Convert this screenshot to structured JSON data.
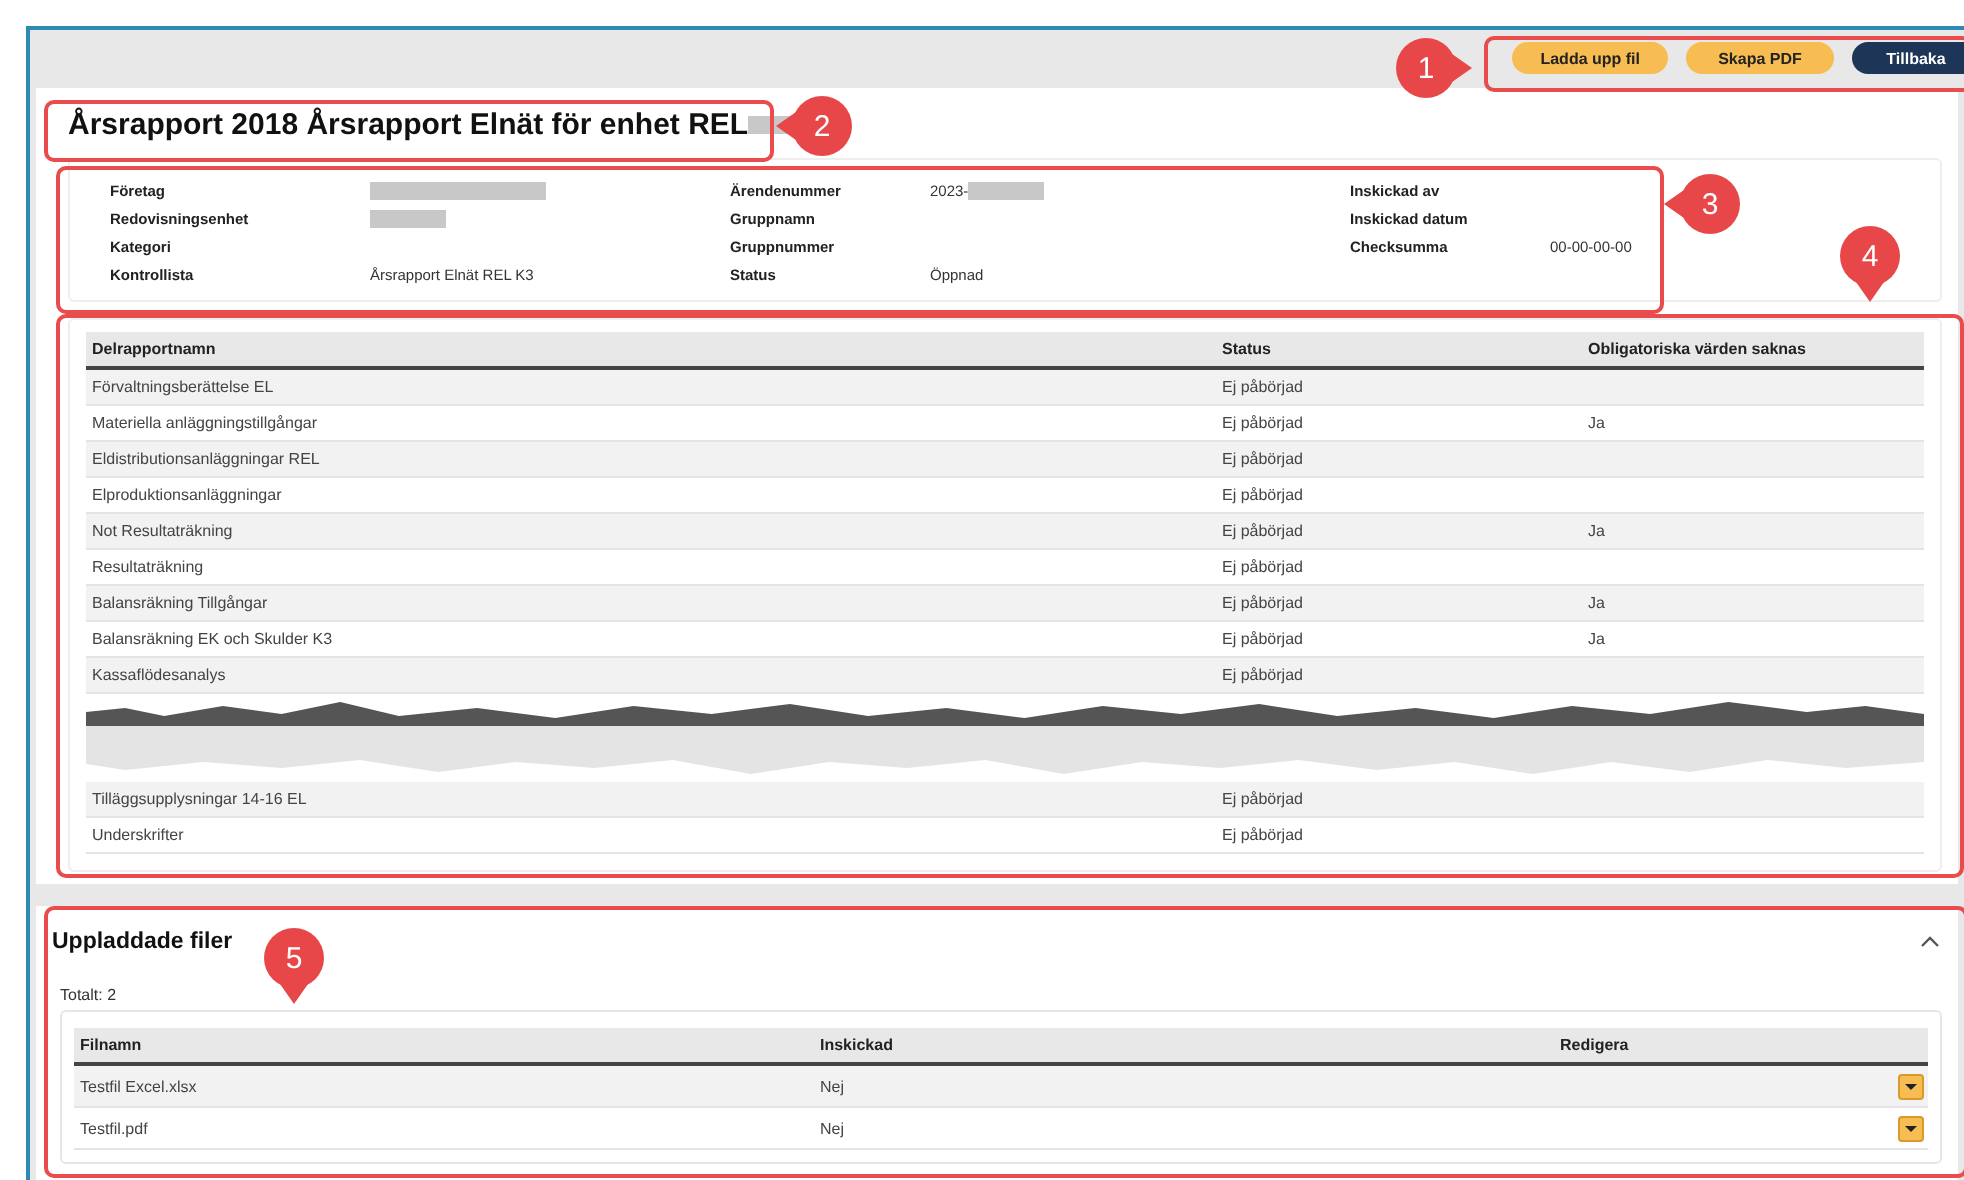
{
  "toolbar": {
    "buttons": [
      {
        "label": "Ladda upp fil",
        "kind": "secondary"
      },
      {
        "label": "Skapa PDF",
        "kind": "secondary"
      },
      {
        "label": "Tillbaka",
        "kind": "primary"
      }
    ]
  },
  "title": {
    "text": "Årsrapport 2018 Årsrapport Elnät för enhet REL",
    "redacted": true
  },
  "info": {
    "columns": [
      [
        {
          "label": "Företag",
          "redacted": true
        },
        {
          "label": "Redovisningsenhet",
          "redacted": true
        },
        {
          "label": "Kategori"
        },
        {
          "label": "Kontrollista",
          "value": "Årsrapport Elnät REL K3"
        }
      ],
      [
        {
          "label": "Ärendenummer",
          "value": "2023-",
          "redacted": true
        },
        {
          "label": "Gruppnamn"
        },
        {
          "label": "Gruppnummer"
        },
        {
          "label": "Status",
          "value": "Öppnad"
        }
      ],
      [
        {
          "label": "Inskickad av"
        },
        {
          "label": "Inskickad datum"
        },
        {
          "label": "Checksumma",
          "value": "00-00-00-00"
        }
      ]
    ]
  },
  "reports": {
    "columns": [
      "Delrapportnamn",
      "Status",
      "Obligatoriska värden saknas"
    ],
    "rows": [
      {
        "name": "Förvaltningsberättelse EL",
        "status": "Ej påbörjad"
      },
      {
        "name": "Materiella anläggningstillgångar",
        "status": "Ej påbörjad",
        "missing": "Ja"
      },
      {
        "name": "Eldistributionsanläggningar REL",
        "status": "Ej påbörjad"
      },
      {
        "name": "Elproduktionsanläggningar",
        "status": "Ej påbörjad"
      },
      {
        "name": "Not Resultaträkning",
        "status": "Ej påbörjad",
        "missing": "Ja"
      },
      {
        "name": "Resultaträkning",
        "status": "Ej påbörjad"
      },
      {
        "name": "Balansräkning Tillgångar",
        "status": "Ej påbörjad",
        "missing": "Ja"
      },
      {
        "name": "Balansräkning EK och Skulder K3",
        "status": "Ej påbörjad",
        "missing": "Ja"
      },
      {
        "name": "Kassaflödesanalys",
        "status": "Ej påbörjad"
      }
    ],
    "rows_after_cut": [
      {
        "name": "Tilläggsupplysningar 14-16 EL",
        "status": "Ej påbörjad"
      },
      {
        "name": "Underskrifter",
        "status": "Ej påbörjad"
      }
    ]
  },
  "uploads": {
    "title": "Uppladdade filer",
    "expanded": true,
    "total": "Totalt: 2",
    "columns": [
      "Filnamn",
      "Inskickad",
      "Redigera"
    ],
    "rows": [
      {
        "name": "Testfil Excel.xlsx",
        "sent": "Nej"
      },
      {
        "name": "Testfil.pdf",
        "sent": "Nej"
      }
    ]
  },
  "callouts": [
    {
      "label": "1"
    },
    {
      "label": "2"
    },
    {
      "label": "3"
    },
    {
      "label": "4"
    },
    {
      "label": "5"
    }
  ]
}
